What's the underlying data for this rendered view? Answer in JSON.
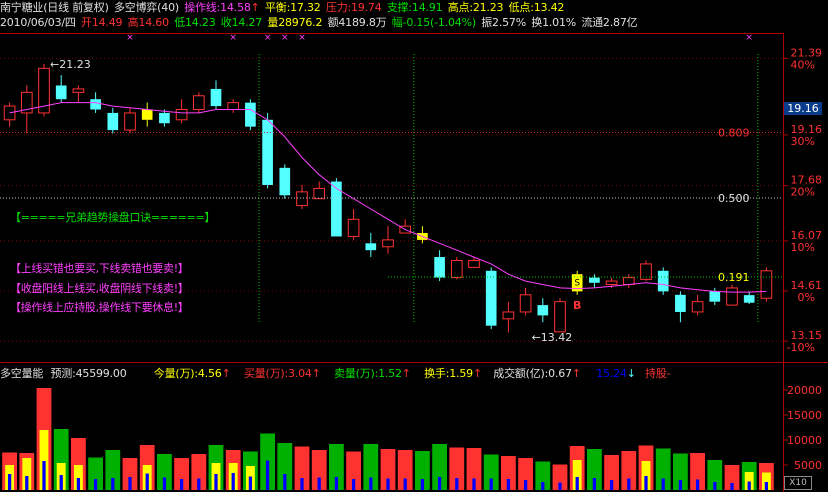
{
  "header": {
    "stock": "南宁糖业(日线 前复权)",
    "indicator": "多空博弈(40)",
    "op_line": "操作线:14.58",
    "balance": "平衡:17.32",
    "pressure": "压力:19.74",
    "support": "支撑:14.91",
    "high_pt": "高点:21.23",
    "low_pt": "低点:13.42",
    "date": "2010/06/03/四",
    "open": "开14.49",
    "high": "高14.60",
    "low": "低14.23",
    "close": "收14.27",
    "volume": "量28976.2",
    "amount": "额4189.8万",
    "change": "幅-0.15(-1.04%)",
    "amplitude": "振2.57%",
    "turnover": "换1.01%",
    "float": "流通2.87亿",
    "arrow": "↑"
  },
  "messages": {
    "slogan": "【=====兄弟趋势操盘口诀======】",
    "line1": "【上线买错也要买,下线卖错也要卖!】",
    "line2": "【收盘阳线上线买,收盘阴线下线卖!】",
    "line3": "【操作线上应持股,操作线下要休息!】"
  },
  "volume_header": {
    "name": "多空量能",
    "forecast": "预测:45599.00",
    "today_vol": "今量(万):4.56",
    "buy_vol": "买量(万):3.04",
    "sell_vol": "卖量(万):1.52",
    "turnover": "换手:1.59",
    "amount": "成交额(亿):0.67",
    "ratio": "15.24",
    "hold": "持股-",
    "up_arrow": "↑",
    "down_arrow": "↓"
  },
  "current_price_tag": "19.16",
  "volume_zoom_tag": "X10",
  "colors": {
    "up": "#ff3232",
    "down": "#54ffff",
    "ma": "#ff40ff",
    "grid": "#ff0000",
    "signal_yellow": "#ffff00",
    "vol_green": "#00b000",
    "vol_blue": "#0000ff",
    "text_red": "#ff3232",
    "text_green": "#00e000",
    "text_magenta": "#ff40ff",
    "text_yellow": "#ffff00",
    "text_white": "#e0e0e0",
    "text_cyan": "#54ffff"
  },
  "chart_data": [
    {
      "type": "candlestick",
      "title": "南宁糖业(日线 前复权)",
      "date": "2010/06/03",
      "ylim": [
        12.6,
        22.1
      ],
      "price_ticks": [
        {
          "price": 21.39,
          "pct": "40%"
        },
        {
          "price": 19.16,
          "pct": "30%"
        },
        {
          "price": 17.68,
          "pct": "20%"
        },
        {
          "price": 16.07,
          "pct": "10%"
        },
        {
          "price": 14.61,
          "pct": "0%"
        },
        {
          "price": 13.15,
          "pct": "-10%"
        }
      ],
      "retracement_lines": [
        {
          "label": "0.809",
          "price": 19.23
        },
        {
          "label": "0.500",
          "price": 17.32
        },
        {
          "label": "0.191",
          "price": 15.02
        }
      ],
      "annotations": [
        {
          "text": "21.23",
          "price": 21.23,
          "index": 2
        },
        {
          "text": "13.42",
          "price": 13.42,
          "index": 30
        }
      ],
      "series": [
        {
          "name": "K线",
          "candles": [
            {
              "o": 19.6,
              "c": 20.0,
              "h": 20.1,
              "l": 19.4
            },
            {
              "o": 19.8,
              "c": 20.4,
              "h": 20.6,
              "l": 19.2
            },
            {
              "o": 19.8,
              "c": 21.1,
              "h": 21.23,
              "l": 19.7
            },
            {
              "o": 20.6,
              "c": 20.2,
              "h": 20.9,
              "l": 20.1
            },
            {
              "o": 20.4,
              "c": 20.5,
              "h": 20.6,
              "l": 20.1
            },
            {
              "o": 20.2,
              "c": 19.9,
              "h": 20.4,
              "l": 19.8
            },
            {
              "o": 19.8,
              "c": 19.3,
              "h": 19.95,
              "l": 19.2
            },
            {
              "o": 19.3,
              "c": 19.8,
              "h": 19.95,
              "l": 19.2
            },
            {
              "o": 19.6,
              "c": 19.9,
              "h": 20.1,
              "l": 19.4
            },
            {
              "o": 19.8,
              "c": 19.5,
              "h": 19.9,
              "l": 19.4
            },
            {
              "o": 19.6,
              "c": 19.9,
              "h": 20.2,
              "l": 19.5
            },
            {
              "o": 19.9,
              "c": 20.3,
              "h": 20.4,
              "l": 19.8
            },
            {
              "o": 20.5,
              "c": 20.0,
              "h": 20.75,
              "l": 19.9
            },
            {
              "o": 19.9,
              "c": 20.1,
              "h": 20.2,
              "l": 19.8
            },
            {
              "o": 20.1,
              "c": 19.4,
              "h": 20.2,
              "l": 19.3
            },
            {
              "o": 19.6,
              "c": 17.7,
              "h": 19.8,
              "l": 17.6
            },
            {
              "o": 18.2,
              "c": 17.4,
              "h": 18.3,
              "l": 17.3
            },
            {
              "o": 17.1,
              "c": 17.5,
              "h": 17.7,
              "l": 17.0
            },
            {
              "o": 17.3,
              "c": 17.6,
              "h": 17.8,
              "l": 17.3
            },
            {
              "o": 17.8,
              "c": 16.2,
              "h": 17.9,
              "l": 16.2
            },
            {
              "o": 16.2,
              "c": 16.7,
              "h": 17.0,
              "l": 16.1
            },
            {
              "o": 16.0,
              "c": 15.8,
              "h": 16.3,
              "l": 15.6
            },
            {
              "o": 15.9,
              "c": 16.1,
              "h": 16.5,
              "l": 15.7
            },
            {
              "o": 16.3,
              "c": 16.5,
              "h": 16.7,
              "l": 16.3
            },
            {
              "o": 16.3,
              "c": 16.1,
              "h": 16.5,
              "l": 16.0
            },
            {
              "o": 15.6,
              "c": 15.0,
              "h": 15.8,
              "l": 14.9
            },
            {
              "o": 15.0,
              "c": 15.5,
              "h": 15.6,
              "l": 14.95
            },
            {
              "o": 15.3,
              "c": 15.5,
              "h": 15.6,
              "l": 15.3
            },
            {
              "o": 15.2,
              "c": 13.6,
              "h": 15.3,
              "l": 13.5
            },
            {
              "o": 13.8,
              "c": 14.0,
              "h": 14.3,
              "l": 13.4
            },
            {
              "o": 14.0,
              "c": 14.5,
              "h": 14.7,
              "l": 13.9
            },
            {
              "o": 14.2,
              "c": 13.9,
              "h": 14.4,
              "l": 13.7
            },
            {
              "o": 13.42,
              "c": 14.3,
              "h": 14.4,
              "l": 13.42
            },
            {
              "o": 14.6,
              "c": 15.1,
              "h": 15.2,
              "l": 14.5
            },
            {
              "o": 15.0,
              "c": 14.85,
              "h": 15.1,
              "l": 14.7
            },
            {
              "o": 14.8,
              "c": 14.9,
              "h": 15.0,
              "l": 14.7
            },
            {
              "o": 14.8,
              "c": 15.0,
              "h": 15.1,
              "l": 14.7
            },
            {
              "o": 14.95,
              "c": 15.4,
              "h": 15.5,
              "l": 14.9
            },
            {
              "o": 15.2,
              "c": 14.6,
              "h": 15.3,
              "l": 14.5
            },
            {
              "o": 14.5,
              "c": 14.0,
              "h": 14.6,
              "l": 13.7
            },
            {
              "o": 14.0,
              "c": 14.3,
              "h": 14.5,
              "l": 13.9
            },
            {
              "o": 14.6,
              "c": 14.3,
              "h": 14.7,
              "l": 14.2
            },
            {
              "o": 14.2,
              "c": 14.7,
              "h": 14.8,
              "l": 14.2
            },
            {
              "o": 14.49,
              "c": 14.27,
              "h": 14.6,
              "l": 14.23
            },
            {
              "o": 14.4,
              "c": 15.2,
              "h": 15.3,
              "l": 14.3
            }
          ]
        },
        {
          "name": "操作线",
          "values": [
            19.8,
            19.9,
            20.0,
            20.1,
            20.1,
            20.1,
            20.0,
            19.95,
            19.9,
            19.85,
            19.8,
            19.8,
            19.9,
            19.9,
            19.9,
            19.6,
            19.1,
            18.5,
            18.0,
            17.6,
            17.3,
            17.0,
            16.7,
            16.4,
            16.2,
            16.0,
            15.8,
            15.6,
            15.4,
            15.1,
            14.9,
            14.8,
            14.7,
            14.68,
            14.7,
            14.75,
            14.8,
            14.85,
            14.8,
            14.7,
            14.65,
            14.6,
            14.58,
            14.58,
            14.6
          ]
        },
        {
          "name": "signals",
          "yellow_candles": [
            8,
            24,
            33
          ],
          "marks": [
            {
              "index": 33,
              "text": "B"
            },
            {
              "index": 33,
              "text": "S"
            }
          ],
          "top_markers": [
            7,
            13,
            15,
            16,
            17,
            43
          ]
        }
      ]
    },
    {
      "type": "bar",
      "title": "多空量能",
      "ylim": [
        0,
        22000
      ],
      "yticks": [
        5000,
        10000,
        15000,
        20000
      ],
      "series": [
        {
          "name": "volume",
          "values": [
            7500,
            7400,
            20400,
            12200,
            10400,
            6500,
            8000,
            6400,
            9000,
            7200,
            6400,
            7200,
            9000,
            8000,
            7700,
            11300,
            9400,
            8700,
            8000,
            9200,
            7700,
            9200,
            8200,
            8000,
            7800,
            9200,
            8500,
            8400,
            7100,
            6800,
            6400,
            5700,
            5100,
            8800,
            8200,
            7000,
            7800,
            8900,
            8300,
            7300,
            7400,
            6000,
            5000,
            5600,
            5400
          ]
        },
        {
          "name": "buy",
          "values": [
            5000,
            6400,
            12000,
            5400,
            5000,
            0,
            0,
            0,
            5000,
            0,
            0,
            0,
            5400,
            5400,
            4800,
            0,
            0,
            0,
            0,
            0,
            0,
            0,
            0,
            0,
            0,
            0,
            0,
            0,
            0,
            0,
            0,
            0,
            0,
            6000,
            0,
            0,
            0,
            5800,
            0,
            0,
            0,
            0,
            0,
            3600,
            3500
          ]
        },
        {
          "name": "blue",
          "values": [
            3200,
            2800,
            5800,
            3000,
            2400,
            2200,
            2400,
            2600,
            3300,
            2500,
            2200,
            2300,
            3200,
            3400,
            2700,
            5900,
            3200,
            2400,
            2500,
            2600,
            2200,
            2500,
            2300,
            2300,
            2200,
            2600,
            2400,
            2300,
            2300,
            2200,
            2000,
            1600,
            1500,
            2600,
            2400,
            2000,
            2300,
            2800,
            2300,
            2000,
            2100,
            1600,
            1400,
            1700,
            1600
          ]
        }
      ]
    }
  ]
}
